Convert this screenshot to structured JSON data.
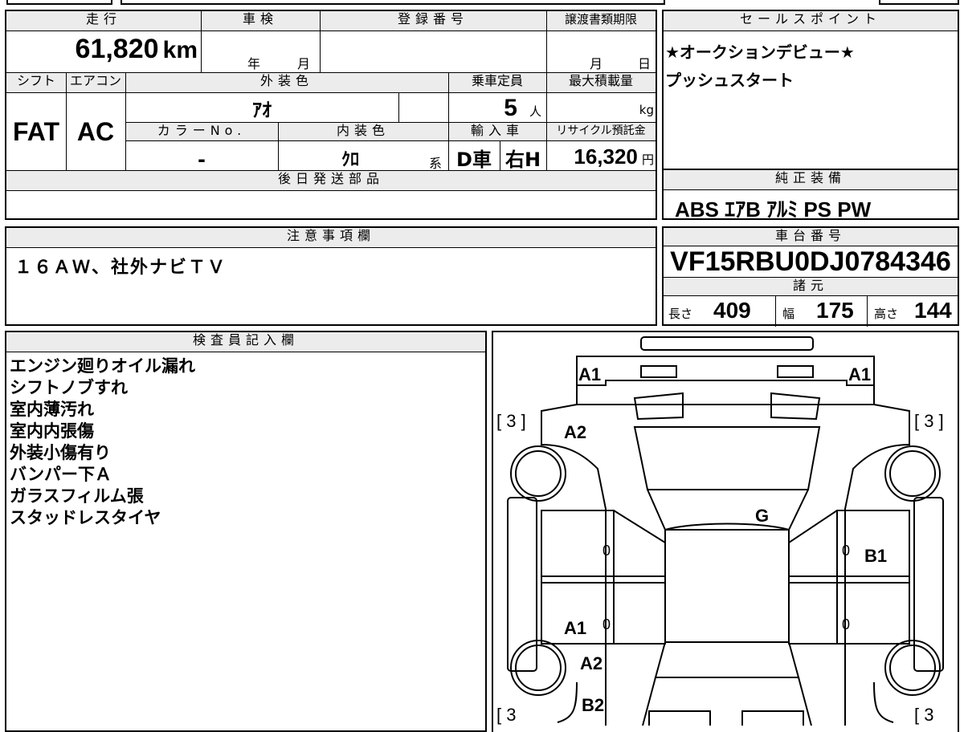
{
  "table": {
    "mileage_header": "走行",
    "mileage_value": "61,820",
    "mileage_unit": "km",
    "inspection_header": "車検",
    "inspection_year": "年",
    "inspection_month": "月",
    "reg_header": "登録番号",
    "transfer_header": "譲渡書類期限",
    "transfer_month": "月",
    "transfer_day": "日",
    "shift_header": "シフト",
    "ac_header": "エアコン",
    "exterior_header": "外装色",
    "capacity_header": "乗車定員",
    "maxload_header": "最大積載量",
    "shift_value": "FAT",
    "ac_value": "AC",
    "exterior_value": "ｱｵ",
    "capacity_value": "5",
    "capacity_unit": "人",
    "maxload_unit": "kg",
    "colorno_header": "カラーNo.",
    "interior_header": "内装色",
    "import_header": "輸入車",
    "recycle_header": "リサイクル預託金",
    "colorno_value": "-",
    "interior_value": "ｸﾛ",
    "interior_suffix": "系",
    "import_dealer": "D車",
    "import_handle": "右H",
    "recycle_value": "16,320",
    "recycle_unit": "円",
    "later_parts_header": "後日発送部品"
  },
  "sales": {
    "header": "セールスポイント",
    "line1": "★オークションデビュー★",
    "line2": "プッシュスタート"
  },
  "equipment": {
    "header": "純正装備",
    "value": "ABS ｴｱB ｱﾙﾐ PS PW"
  },
  "notes": {
    "header": "注意事項欄",
    "value": "１６ＡＷ、社外ナビＴＶ"
  },
  "chassis": {
    "header": "車台番号",
    "value": "VF15RBU0DJ0784346"
  },
  "specs": {
    "header": "諸元",
    "length_label": "長さ",
    "length_value": "409",
    "width_label": "幅",
    "width_value": "175",
    "height_label": "高さ",
    "height_value": "144"
  },
  "inspector": {
    "header": "検査員記入欄",
    "lines": [
      "エンジン廻りオイル漏れ",
      "シフトノブすれ",
      "室内薄汚れ",
      "室内内張傷",
      "外装小傷有り",
      "バンパー下Ａ",
      "ガラスフィルム張",
      "スタッドレスタイヤ"
    ]
  },
  "diagram": {
    "a1_left_top": "A1",
    "a1_right_top": "A1",
    "bracket_tl": "[ 3 ]",
    "bracket_tr": "[ 3 ]",
    "bracket_bl": "[ 3",
    "bracket_br": "[ 3",
    "a2_top": "A2",
    "g": "G",
    "b1": "B1",
    "zero_left_1": "0",
    "zero_right_1": "0",
    "a1_lower": "A1",
    "zero_left_2": "0",
    "zero_right_2": "0",
    "a2_lower": "A2",
    "b2": "B2"
  }
}
